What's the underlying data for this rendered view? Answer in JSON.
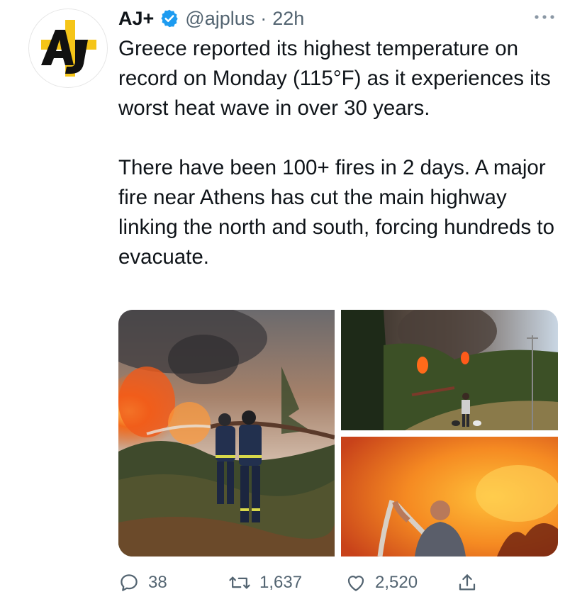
{
  "account": {
    "name": "AJ+",
    "handle": "@ajplus",
    "separator": "·",
    "time": "22h",
    "verified": true,
    "avatar_icon": "aj-plus-logo",
    "avatar_text": "AJ+"
  },
  "tweet": {
    "text": "Greece reported its highest temperature on record on Monday (115°F) as it experiences its worst heat wave in over 30 years.\n\nThere have been 100+ fires in 2 days. A major fire near Athens has cut the main highway linking the north and south, forcing hundreds to evacuate."
  },
  "media": [
    {
      "icon": "firefighters-hose-photo"
    },
    {
      "icon": "man-walking-dog-smoke-photo"
    },
    {
      "icon": "man-with-hose-fire-photo"
    }
  ],
  "actions": {
    "replies": "38",
    "retweets": "1,637",
    "likes": "2,520"
  },
  "colors": {
    "verified_blue": "#1d9bf0",
    "logo_yellow": "#f5c518",
    "secondary_text": "#536471",
    "primary_text": "#0f1419"
  }
}
